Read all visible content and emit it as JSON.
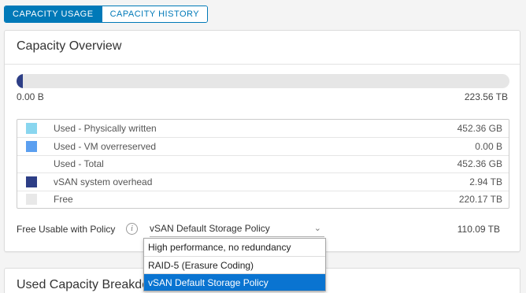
{
  "tabs": [
    {
      "label": "CAPACITY USAGE",
      "active": true
    },
    {
      "label": "CAPACITY HISTORY",
      "active": false
    }
  ],
  "overview": {
    "title": "Capacity Overview",
    "bar": {
      "min_label": "0.00 B",
      "max_label": "223.56 TB",
      "used_fraction": 0.013,
      "fill_color": "#2d3e86",
      "track_color": "#e6e6e6"
    },
    "legend": [
      {
        "color": "#89d6ef",
        "label": "Used - Physically written",
        "value": "452.36 GB"
      },
      {
        "color": "#5b9ff0",
        "label": "Used - VM overreserved",
        "value": "0.00 B"
      },
      {
        "color": "",
        "label": "Used - Total",
        "value": "452.36 GB"
      },
      {
        "color": "#2d3e86",
        "label": "vSAN system overhead",
        "value": "2.94 TB"
      },
      {
        "color": "#e8e8e8",
        "label": "Free",
        "value": "220.17 TB"
      }
    ],
    "policy": {
      "label": "Free Usable with Policy",
      "info_icon": "info-icon",
      "selected": "vSAN Default Storage Policy",
      "value": "110.09 TB",
      "options": [
        {
          "label": "High performance, no redundancy",
          "selected": false
        },
        {
          "label": "RAID-5 (Erasure Coding)",
          "selected": false
        },
        {
          "label": "vSAN Default Storage Policy",
          "selected": true
        }
      ]
    }
  },
  "breakdown": {
    "title": "Used Capacity Breakdown"
  },
  "colors": {
    "accent": "#0079b8",
    "menu_selected": "#0a74d1"
  }
}
